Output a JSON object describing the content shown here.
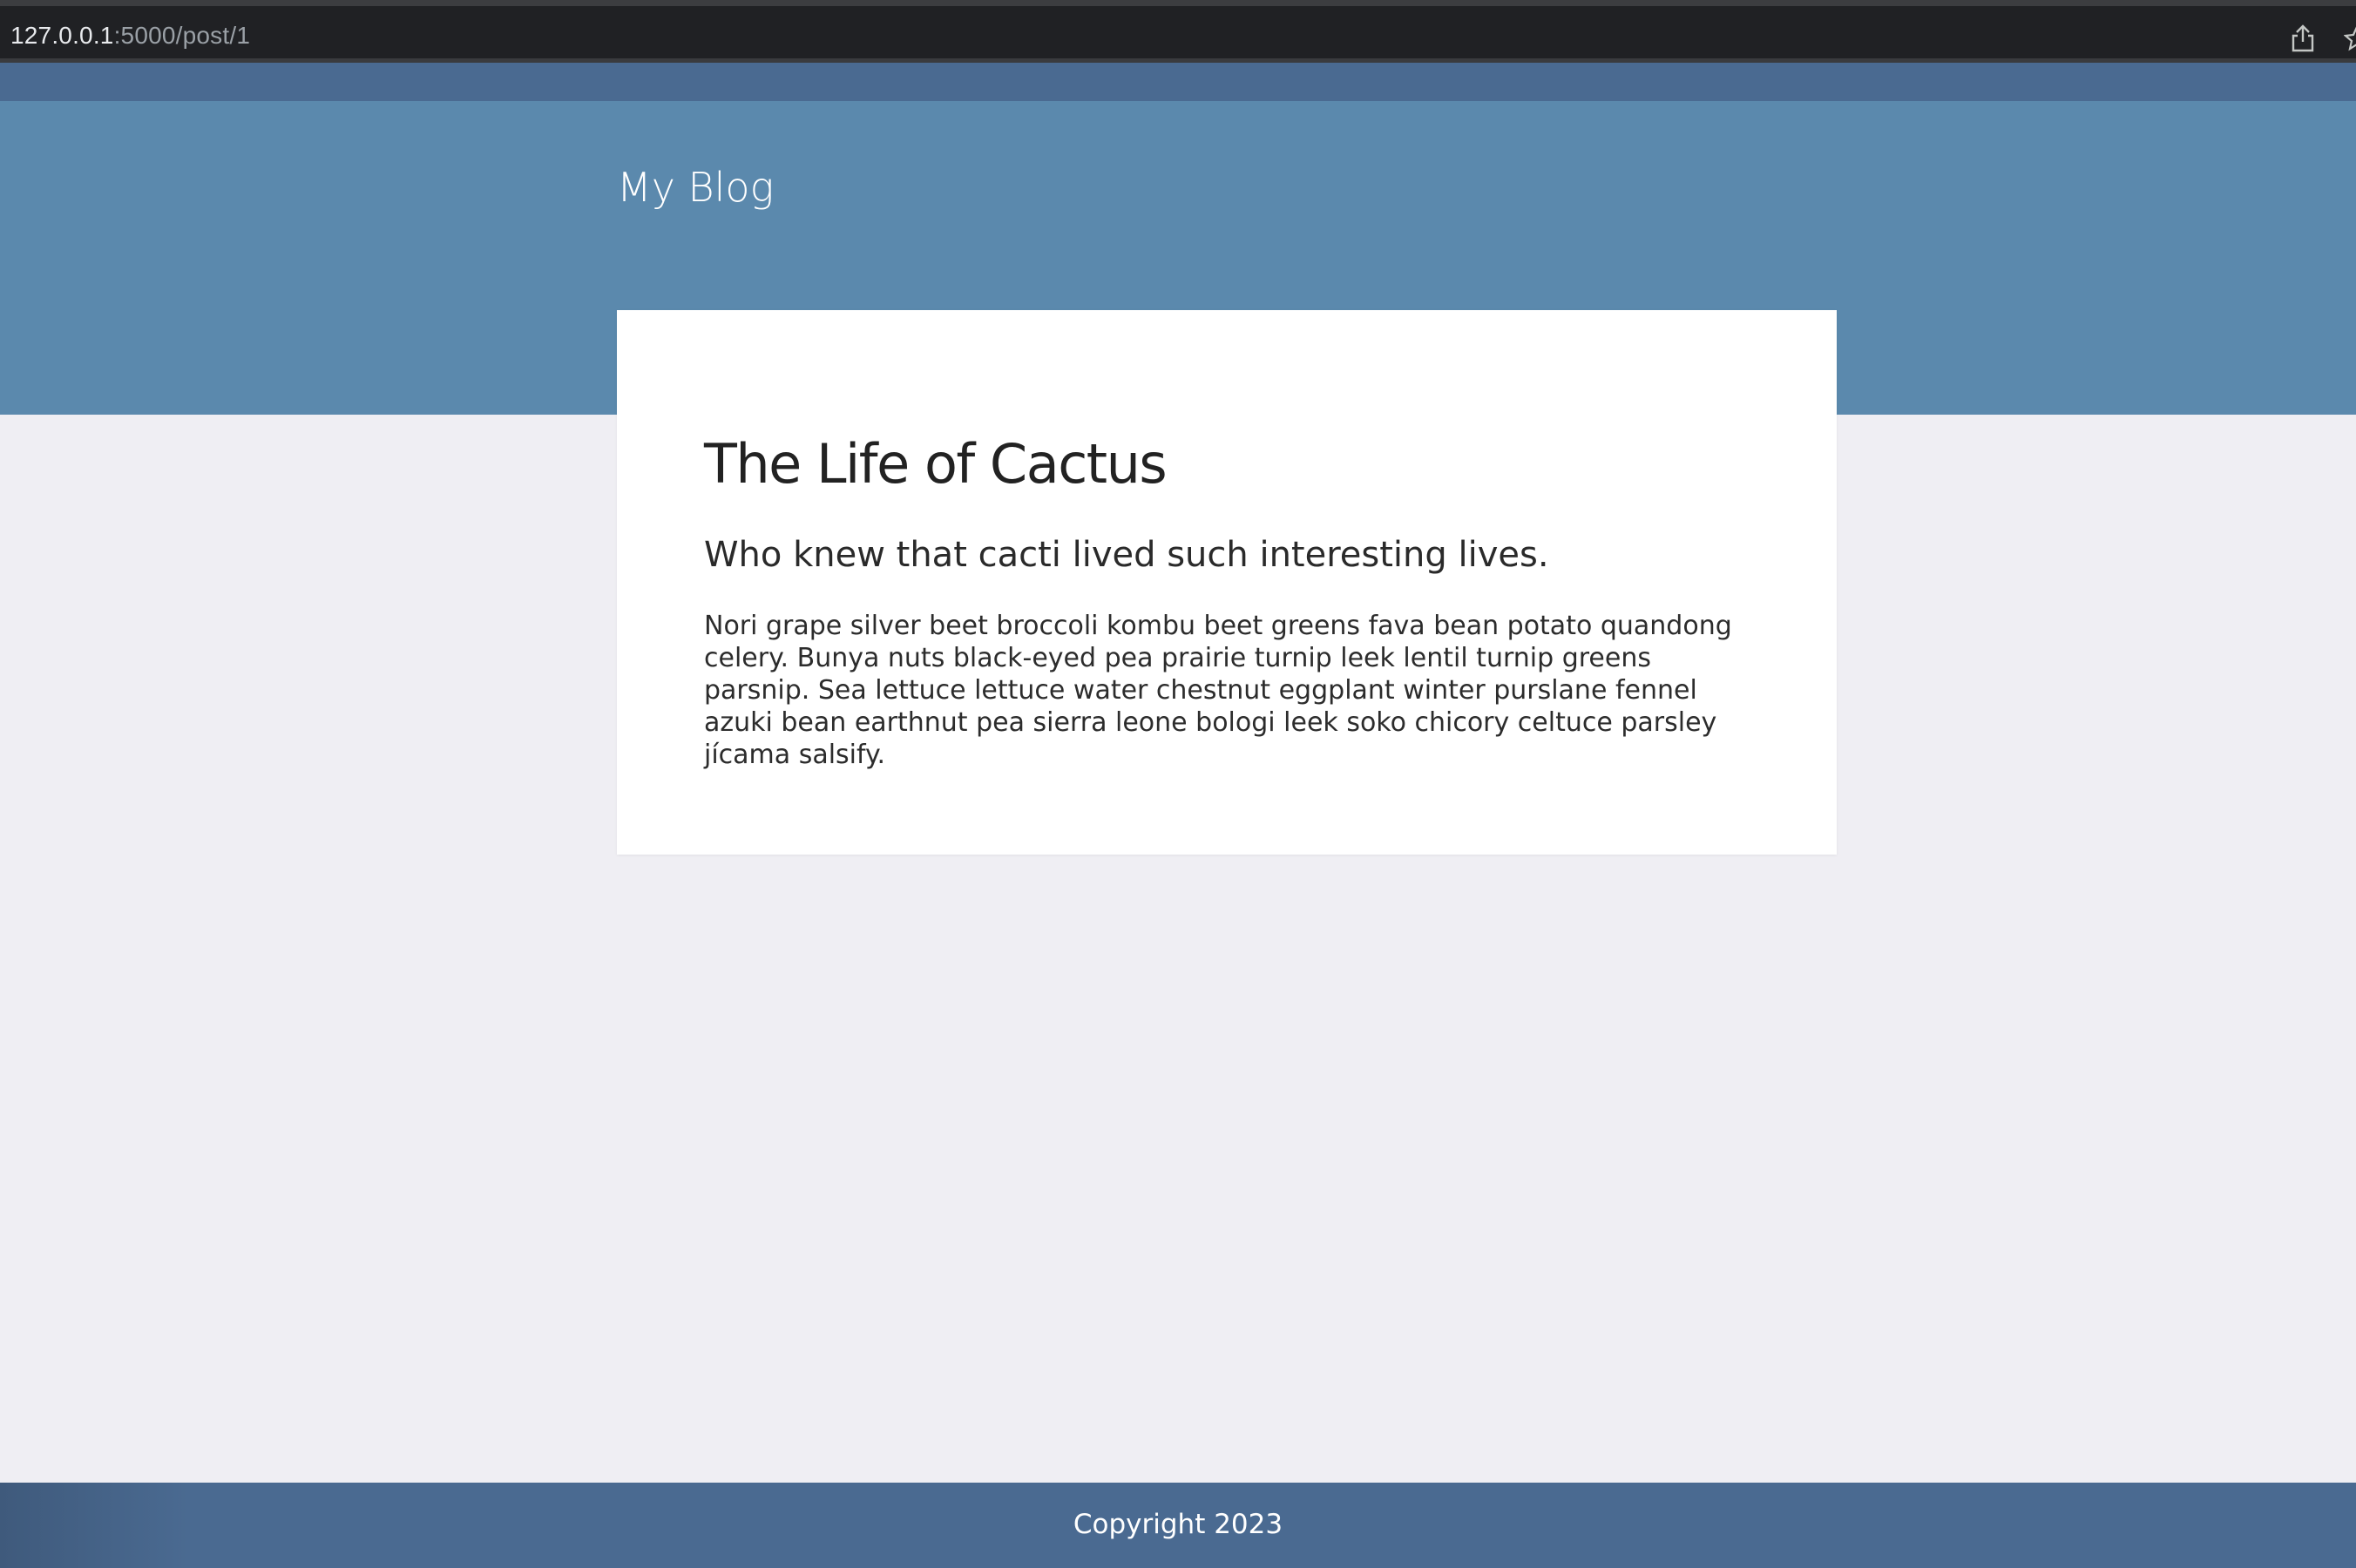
{
  "browser": {
    "url_host": "127.0.0.1",
    "url_path": ":5000/post/1"
  },
  "header": {
    "brand": "My Blog"
  },
  "post": {
    "title": "The Life of Cactus",
    "subtitle": "Who knew that cacti lived such interesting lives.",
    "body": "Nori grape silver beet broccoli kombu beet greens fava bean potato quandong celery. Bunya nuts black-eyed pea prairie turnip leek lentil turnip greens parsnip. Sea lettuce lettuce water chestnut eggplant winter purslane fennel azuki bean earthnut pea sierra leone bologi leek soko chicory celtuce parsley jícama salsify."
  },
  "footer": {
    "copyright": "Copyright 2023"
  },
  "icons": {
    "share": "share-icon",
    "bookmark": "star-icon"
  },
  "colors": {
    "header_bg": "#5b89ad",
    "nav_bg": "#4a6a91",
    "page_bg": "#efeef3",
    "card_bg": "#ffffff"
  }
}
